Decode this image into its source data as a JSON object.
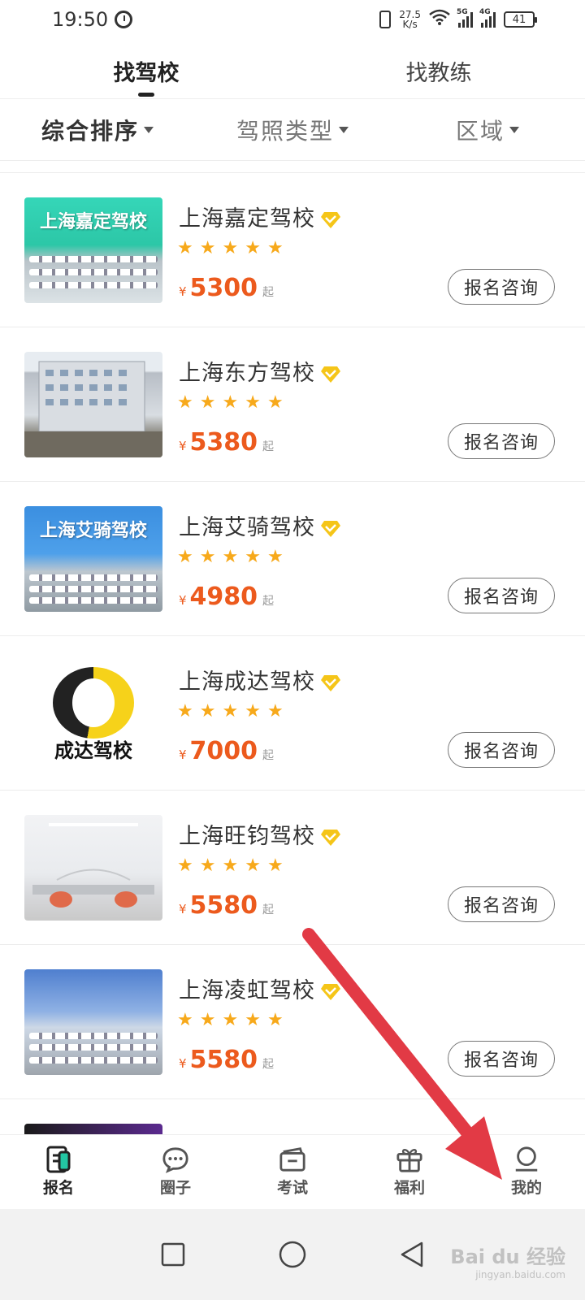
{
  "status_bar": {
    "time": "19:50",
    "net_speed_value": "27.5",
    "net_speed_unit": "K/s",
    "sig1_tag": "5G",
    "sig2_tag": "4G",
    "battery": "41"
  },
  "top_tabs": [
    {
      "label": "找驾校",
      "active": true
    },
    {
      "label": "找教练",
      "active": false
    }
  ],
  "filters": [
    {
      "label": "综合排序",
      "active": true
    },
    {
      "label": "驾照类型",
      "active": false
    },
    {
      "label": "区域",
      "active": false
    }
  ],
  "schools": [
    {
      "name": "上海嘉定驾校",
      "thumb_text": "上海嘉定驾校",
      "stars": 5,
      "currency": "¥",
      "price": "5300",
      "suffix": "起",
      "button": "报名咨询"
    },
    {
      "name": "上海东方驾校",
      "thumb_text": "",
      "stars": 5,
      "currency": "¥",
      "price": "5380",
      "suffix": "起",
      "button": "报名咨询"
    },
    {
      "name": "上海艾骑驾校",
      "thumb_text": "上海艾骑驾校",
      "stars": 5,
      "currency": "¥",
      "price": "4980",
      "suffix": "起",
      "button": "报名咨询"
    },
    {
      "name": "上海成达驾校",
      "thumb_text": "成达驾校",
      "stars": 5,
      "currency": "¥",
      "price": "7000",
      "suffix": "起",
      "button": "报名咨询"
    },
    {
      "name": "上海旺钧驾校",
      "thumb_text": "",
      "stars": 5,
      "currency": "¥",
      "price": "5580",
      "suffix": "起",
      "button": "报名咨询"
    },
    {
      "name": "上海凌虹驾校",
      "thumb_text": "",
      "stars": 5,
      "currency": "¥",
      "price": "5580",
      "suffix": "起",
      "button": "报名咨询"
    }
  ],
  "bottom_nav": [
    {
      "label": "报名",
      "icon": "signup-icon",
      "active": true
    },
    {
      "label": "圈子",
      "icon": "chat-icon",
      "active": false
    },
    {
      "label": "考试",
      "icon": "exam-icon",
      "active": false
    },
    {
      "label": "福利",
      "icon": "gift-icon",
      "active": false
    },
    {
      "label": "我的",
      "icon": "profile-icon",
      "active": false
    }
  ],
  "colors": {
    "price": "#ec5a1d",
    "star": "#f7a91b",
    "verified": "#f5c518",
    "arrow": "#e23a45"
  },
  "watermark": {
    "brand": "Bai du 经验",
    "url": "jingyan.baidu.com"
  }
}
